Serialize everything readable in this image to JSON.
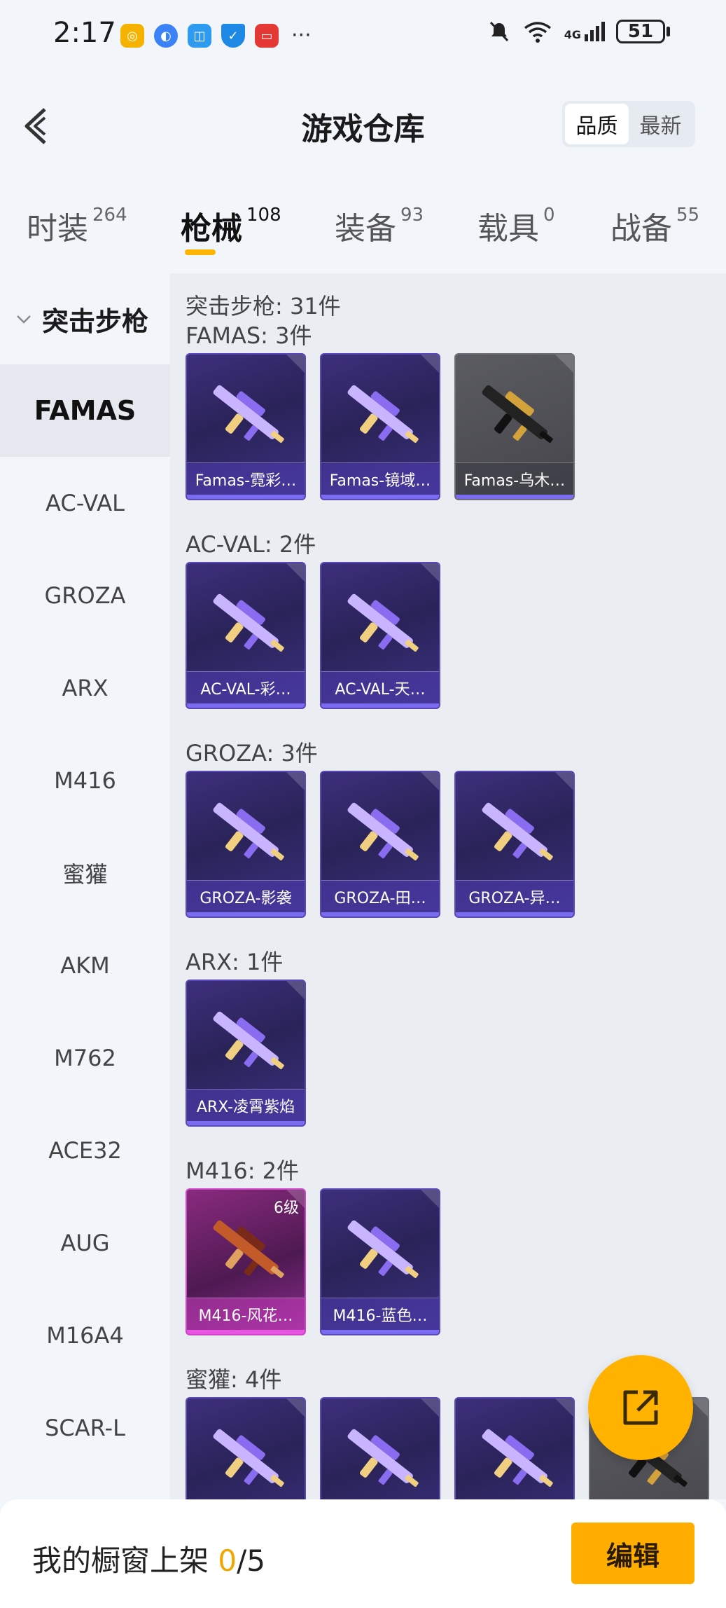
{
  "status_bar": {
    "time": "2:17",
    "battery": "51",
    "network": "4G",
    "icons": [
      "app-icon",
      "browser-icon",
      "app-icon",
      "shield-icon",
      "app-icon",
      "more-icon",
      "mute-icon",
      "wifi-icon",
      "signal-icon",
      "battery-icon"
    ],
    "more": "···"
  },
  "header": {
    "title": "游戏仓库",
    "sort_options": [
      "品质",
      "最新"
    ],
    "sort_selected": "品质"
  },
  "tabs": [
    {
      "label": "时装",
      "count": "264"
    },
    {
      "label": "枪械",
      "count": "108"
    },
    {
      "label": "装备",
      "count": "93"
    },
    {
      "label": "载具",
      "count": "0"
    },
    {
      "label": "战备",
      "count": "55"
    }
  ],
  "sidebar": {
    "group_label": "突击步枪",
    "items": [
      "FAMAS",
      "AC-VAL",
      "GROZA",
      "ARX",
      "M416",
      "蜜獾",
      "AKM",
      "M762",
      "ACE32",
      "AUG",
      "M16A4",
      "SCAR-L"
    ]
  },
  "content": {
    "total": "突击步枪: 31件",
    "sections": [
      {
        "title": "FAMAS: 3件",
        "items": [
          {
            "name": "Famas-霓彩…",
            "style": "purple"
          },
          {
            "name": "Famas-镜域…",
            "style": "purple"
          },
          {
            "name": "Famas-乌木…",
            "style": "gray"
          }
        ]
      },
      {
        "title": "AC-VAL: 2件",
        "items": [
          {
            "name": "AC-VAL-彩…",
            "style": "purple"
          },
          {
            "name": "AC-VAL-天…",
            "style": "purple"
          }
        ]
      },
      {
        "title": "GROZA: 3件",
        "items": [
          {
            "name": "GROZA-影袭",
            "style": "purple"
          },
          {
            "name": "GROZA-田…",
            "style": "purple"
          },
          {
            "name": "GROZA-异…",
            "style": "purple"
          }
        ]
      },
      {
        "title": "ARX: 1件",
        "items": [
          {
            "name": "ARX-凌霄紫焰",
            "style": "purple"
          }
        ]
      },
      {
        "title": "M416: 2件",
        "items": [
          {
            "name": "M416-风花…",
            "style": "pink",
            "level": "6级"
          },
          {
            "name": "M416-蓝色…",
            "style": "purple"
          }
        ]
      },
      {
        "title": "蜜獾: 4件",
        "items": [
          {
            "name": "",
            "style": "purple"
          },
          {
            "name": "",
            "style": "purple"
          },
          {
            "name": "",
            "style": "purple"
          },
          {
            "name": "",
            "style": "gray"
          }
        ]
      }
    ]
  },
  "fab": {
    "icon": "share-external-icon"
  },
  "bottom_bar": {
    "label": "我的橱窗上架",
    "count_current": "0",
    "count_total": "/5",
    "edit_label": "编辑"
  },
  "colors": {
    "accent": "#ffb400",
    "card_purple": "#2a2358",
    "card_pink": "#8a2a7e",
    "card_gray": "#5b5b62"
  }
}
